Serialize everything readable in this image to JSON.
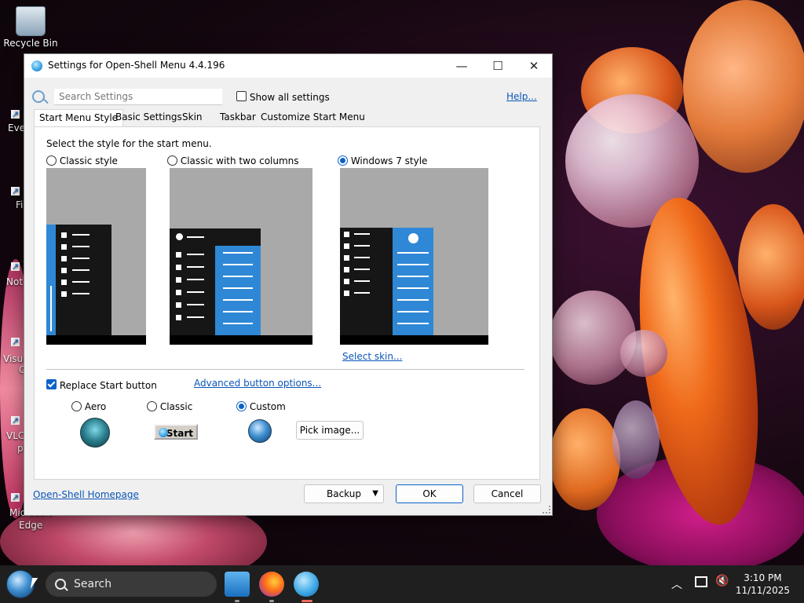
{
  "desktop": {
    "icons": [
      {
        "label": "Recycle Bin"
      },
      {
        "label": "Eve"
      },
      {
        "label": "Fi"
      },
      {
        "label": "Not"
      },
      {
        "label": "Visua"
      },
      {
        "label": "C"
      },
      {
        "label": "VLC"
      },
      {
        "label": "p"
      },
      {
        "label": "Microsoft"
      },
      {
        "label": "Edge"
      }
    ]
  },
  "dialog": {
    "title": "Settings for Open-Shell Menu 4.4.196",
    "window_buttons": {
      "minimize": "—",
      "maximize": "☐",
      "close": "✕"
    },
    "search": {
      "placeholder": "Search Settings"
    },
    "show_all_settings": {
      "label": "Show all settings",
      "checked": false
    },
    "help_link": "Help...",
    "tabs": [
      {
        "label": "Start Menu Style",
        "active": true
      },
      {
        "label": "Basic Settings",
        "active": false
      },
      {
        "label": "Skin",
        "active": false
      },
      {
        "label": "Taskbar",
        "active": false
      },
      {
        "label": "Customize Start Menu",
        "active": false
      }
    ],
    "panel": {
      "instruction": "Select the style for the start menu.",
      "styles": [
        {
          "label": "Classic style",
          "checked": false
        },
        {
          "label": "Classic with two columns",
          "checked": false
        },
        {
          "label": "Windows 7 style",
          "checked": true
        }
      ],
      "select_skin_link": "Select skin...",
      "replace_start_button": {
        "label": "Replace Start button",
        "checked": true
      },
      "advanced_button_options_link": "Advanced button options...",
      "button_styles": [
        {
          "label": "Aero",
          "checked": false
        },
        {
          "label": "Classic",
          "checked": false
        },
        {
          "label": "Custom",
          "checked": true
        }
      ],
      "classic_start_label": "Start",
      "pick_image_button": "Pick image..."
    },
    "footer": {
      "homepage_link": "Open-Shell Homepage",
      "backup_button": "Backup",
      "ok_button": "OK",
      "cancel_button": "Cancel"
    }
  },
  "taskbar": {
    "search_label": "Search",
    "apps": [
      "photos-app-icon",
      "firefox-icon",
      "open-shell-settings-icon"
    ],
    "clock": {
      "time": "3:10 PM",
      "date": "11/11/2025"
    }
  },
  "colors": {
    "accent": "#0b62c8",
    "link": "#0a56b8",
    "preview_blue": "#2f88d6",
    "taskbar": "#1f1f1f"
  }
}
